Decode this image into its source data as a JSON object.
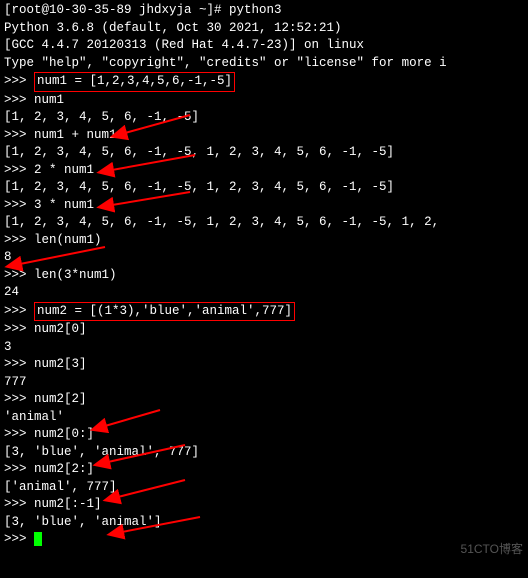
{
  "header": {
    "host_line": "[root@10-30-35-89 jhdxyja ~]# python3",
    "version_line": "Python 3.6.8 (default, Oct 30 2021, 12:52:21)",
    "gcc_line": "[GCC 4.4.7 20120313 (Red Hat 4.4.7-23)] on linux",
    "help_line": "Type \"help\", \"copyright\", \"credits\" or \"license\" for more i"
  },
  "session": {
    "l1_prompt": ">>> ",
    "l1_code": "num1 = [1,2,3,4,5,6,-1,-5]",
    "l2_prompt": ">>> ",
    "l2_code": "num1",
    "l3_out": "[1, 2, 3, 4, 5, 6, -1, -5]",
    "l4_prompt": ">>> ",
    "l4_code": "num1 + num1",
    "l5_out": "[1, 2, 3, 4, 5, 6, -1, -5, 1, 2, 3, 4, 5, 6, -1, -5]",
    "l6_prompt": ">>> ",
    "l6_code": "2 * num1",
    "l7_out": "[1, 2, 3, 4, 5, 6, -1, -5, 1, 2, 3, 4, 5, 6, -1, -5]",
    "l8_prompt": ">>> ",
    "l8_code": "3 * num1",
    "l9_out": "[1, 2, 3, 4, 5, 6, -1, -5, 1, 2, 3, 4, 5, 6, -1, -5, 1, 2,",
    "l10_prompt": ">>> ",
    "l10_code": "len(num1)",
    "l11_out": "8",
    "l12_prompt": ">>> ",
    "l12_code": "len(3*num1)",
    "l13_out": "24",
    "l14_prompt": ">>> ",
    "l14_code": "num2 = [(1*3),'blue','animal',777]",
    "l15_prompt": ">>> ",
    "l15_code": "num2[0]",
    "l16_out": "3",
    "l17_prompt": ">>> ",
    "l17_code": "num2[3]",
    "l18_out": "777",
    "l19_prompt": ">>> ",
    "l19_code": "num2[2]",
    "l20_out": "'animal'",
    "l21_prompt": ">>> ",
    "l21_code": "num2[0:]",
    "l22_out": "[3, 'blue', 'animal', 777]",
    "l23_prompt": ">>> ",
    "l23_code": "num2[2:]",
    "l24_out": "['animal', 777]",
    "l25_prompt": ">>> ",
    "l25_code": "num2[:-1]",
    "l26_out": "[3, 'blue', 'animal']",
    "l27_prompt": ">>> "
  },
  "watermark": "51CTO博客"
}
